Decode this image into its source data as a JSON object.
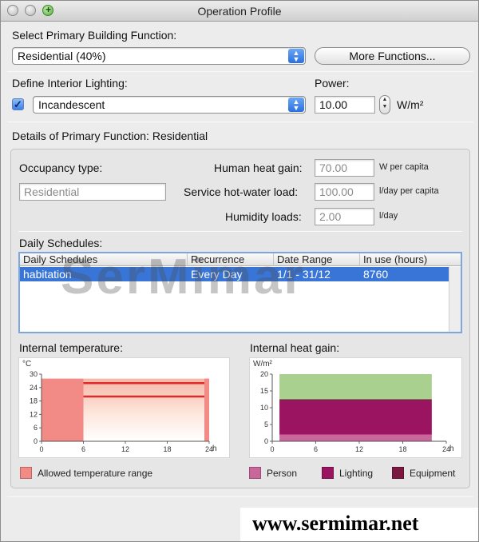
{
  "window": {
    "title": "Operation Profile"
  },
  "building_function": {
    "label": "Select Primary Building Function:",
    "selected": "Residential (40%)",
    "more_button": "More Functions..."
  },
  "lighting": {
    "label": "Define Interior Lighting:",
    "checked": true,
    "selected": "Incandescent",
    "power_label": "Power:",
    "power_value": "10.00",
    "power_unit": "W/m²"
  },
  "details": {
    "heading": "Details of Primary Function: Residential",
    "occupancy_label": "Occupancy type:",
    "occupancy_value": "Residential",
    "human_heat_label": "Human heat gain:",
    "human_heat_value": "70.00",
    "human_heat_unit": "W per capita",
    "hot_water_label": "Service hot-water load:",
    "hot_water_value": "100.00",
    "hot_water_unit": "l/day per capita",
    "humidity_label": "Humidity loads:",
    "humidity_value": "2.00",
    "humidity_unit": "l/day"
  },
  "schedules": {
    "label": "Daily Schedules:",
    "columns": [
      "Daily Schedules",
      "Recurrence",
      "Date Range",
      "In use (hours)"
    ],
    "rows": [
      [
        "habitation",
        "Every Day",
        "1/1 - 31/12",
        "8760"
      ]
    ]
  },
  "chart_data": [
    {
      "type": "area",
      "title": "Internal temperature:",
      "ylabel": "°C",
      "xlabel": "h",
      "x_ticks": [
        0,
        6,
        12,
        18,
        24
      ],
      "y_ticks": [
        0,
        6,
        12,
        18,
        24,
        30
      ],
      "xlim": [
        0,
        24
      ],
      "ylim": [
        0,
        30
      ],
      "series": [
        {
          "name": "Allowed temperature range",
          "x_range": [
            0,
            6
          ],
          "y_range": [
            0,
            28
          ]
        },
        {
          "x_range": [
            6,
            24
          ],
          "y_range": [
            0,
            28
          ]
        }
      ],
      "setpoint_lines": [
        26,
        20
      ],
      "legend": [
        "Allowed temperature range"
      ],
      "colors": {
        "range": "#f28a86",
        "line": "#e02a2a"
      }
    },
    {
      "type": "area",
      "title": "Internal heat gain:",
      "ylabel": "W/m²",
      "xlabel": "h",
      "x_ticks": [
        0,
        6,
        12,
        18,
        24
      ],
      "y_ticks": [
        0,
        5,
        10,
        15,
        20
      ],
      "xlim": [
        0,
        24
      ],
      "ylim": [
        0,
        20
      ],
      "x_extent": [
        1,
        22
      ],
      "series": [
        {
          "name": "Person",
          "value": 2
        },
        {
          "name": "Lighting",
          "value": 10
        },
        {
          "name": "Equipment",
          "value": 0.5
        }
      ],
      "top_band": [
        12.5,
        20
      ],
      "colors": {
        "Person": "#c9669a",
        "Lighting": "#9a1462",
        "Equipment": "#7a1840",
        "band": "#a9d08e"
      }
    }
  ],
  "legend": {
    "temperature": "Allowed temperature range",
    "person": "Person",
    "lighting": "Lighting",
    "equipment": "Equipment"
  },
  "watermarks": {
    "logo": "SerMimar",
    "url": "www.sermimar.net"
  }
}
